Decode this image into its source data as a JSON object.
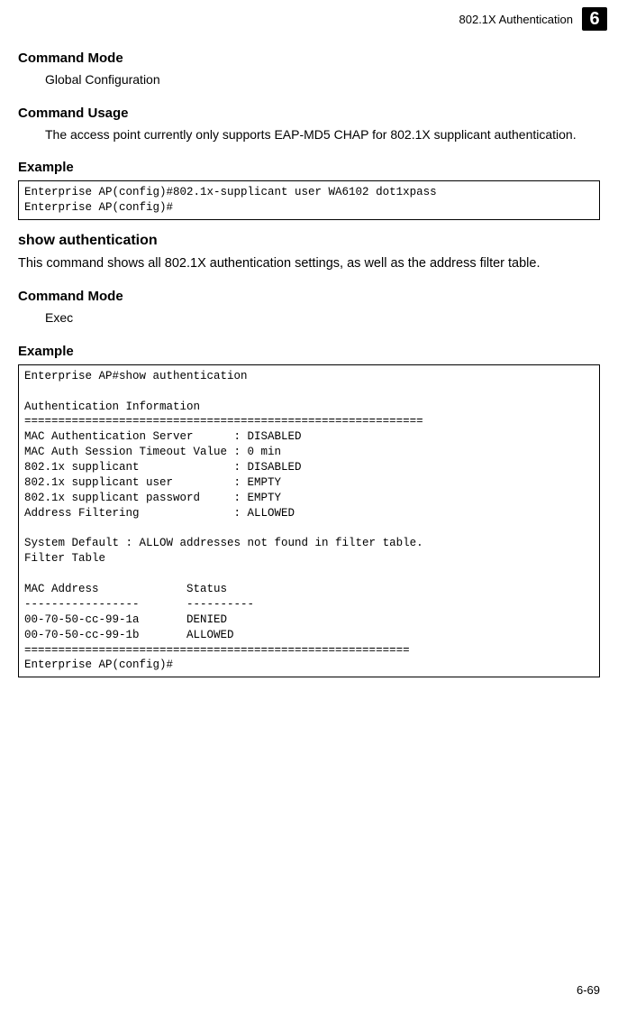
{
  "header": {
    "title": "802.1X Authentication",
    "chapter": "6"
  },
  "s1": {
    "heading": "Command Mode",
    "body": "Global Configuration"
  },
  "s2": {
    "heading": "Command Usage",
    "body": "The access point currently only supports EAP-MD5 CHAP for 802.1X supplicant authentication."
  },
  "s3": {
    "heading": "Example",
    "code": "Enterprise AP(config)#802.1x-supplicant user WA6102 dot1xpass\nEnterprise AP(config)#"
  },
  "s4": {
    "title": "show authentication",
    "desc": "This command shows all 802.1X authentication settings, as well as the address filter table."
  },
  "s5": {
    "heading": "Command Mode",
    "body": "Exec"
  },
  "s6": {
    "heading": "Example",
    "code": "Enterprise AP#show authentication\n\nAuthentication Information\n===========================================================\nMAC Authentication Server      : DISABLED\nMAC Auth Session Timeout Value : 0 min\n802.1x supplicant              : DISABLED\n802.1x supplicant user         : EMPTY\n802.1x supplicant password     : EMPTY\nAddress Filtering              : ALLOWED\n\nSystem Default : ALLOW addresses not found in filter table.\nFilter Table\n\nMAC Address             Status\n-----------------       ----------\n00-70-50-cc-99-1a       DENIED\n00-70-50-cc-99-1b       ALLOWED\n=========================================================\nEnterprise AP(config)#"
  },
  "footer": {
    "page": "6-69"
  }
}
